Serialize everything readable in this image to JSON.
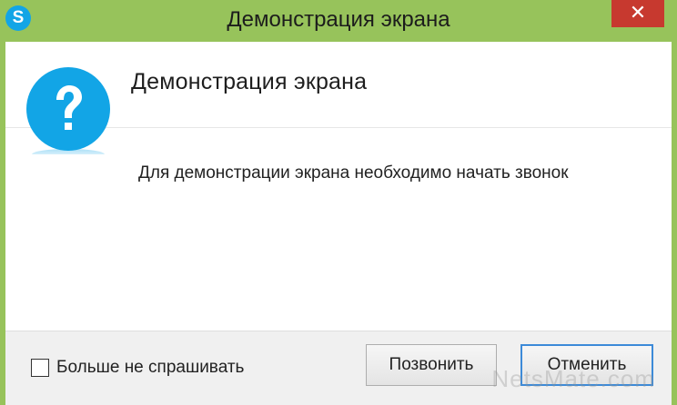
{
  "window": {
    "title": "Демонстрация экрана",
    "app_icon_letter": "S",
    "close_glyph": "✕"
  },
  "dialog": {
    "heading": "Демонстрация экрана",
    "message": "Для демонстрации экрана необходимо начать звонок",
    "icon": "question-icon"
  },
  "footer": {
    "checkbox_label": "Больше не спрашивать",
    "checkbox_checked": false,
    "call_button": "Позвонить",
    "cancel_button": "Отменить"
  },
  "watermark": "NetsMate.com",
  "colors": {
    "title_bar": "#97c35b",
    "close_button": "#c7392f",
    "skype_blue": "#12a5e6",
    "default_button_border": "#3c8ad8"
  }
}
